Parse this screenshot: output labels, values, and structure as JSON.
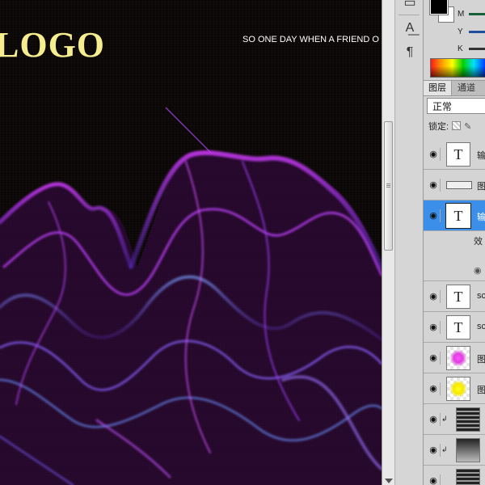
{
  "canvas": {
    "logo_text": "LOGO",
    "tagline": "SO ONE DAY WHEN A FRIEND O"
  },
  "color_panel": {
    "channels": [
      "M",
      "Y",
      "K"
    ],
    "slider_colors": [
      "#1b5e3a",
      "#1f4f9a",
      "#333333"
    ]
  },
  "layers_panel": {
    "tabs": [
      "图层",
      "通道"
    ],
    "blend_mode": "正常",
    "lock_label": "锁定:",
    "layers": [
      {
        "thumb": "T",
        "kind": "text",
        "name": "输"
      },
      {
        "thumb": "",
        "kind": "shape",
        "name": "图"
      },
      {
        "thumb": "T",
        "kind": "text",
        "name": "输",
        "selected": true
      },
      {
        "thumb": "T",
        "kind": "text",
        "name": "sc"
      },
      {
        "thumb": "T",
        "kind": "text",
        "name": "sc"
      },
      {
        "thumb": "",
        "kind": "magenta",
        "name": "图"
      },
      {
        "thumb": "",
        "kind": "yellow",
        "name": "图"
      },
      {
        "thumb": "",
        "kind": "grad",
        "name": ""
      },
      {
        "thumb": "",
        "kind": "grad2",
        "name": ""
      },
      {
        "thumb": "",
        "kind": "grad",
        "name": ""
      }
    ],
    "effects_label": "效",
    "eye_glyph": "👁"
  }
}
